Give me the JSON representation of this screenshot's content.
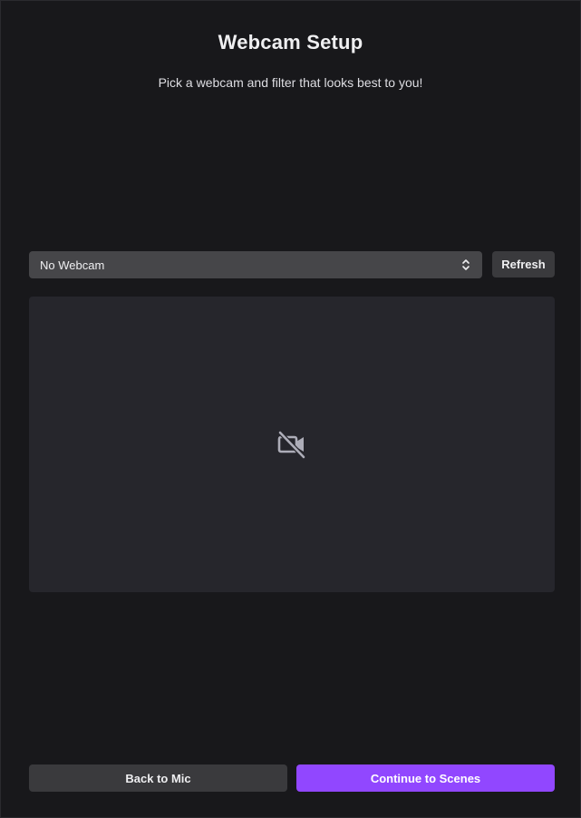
{
  "header": {
    "title": "Webcam Setup",
    "subtitle": "Pick a webcam and filter that looks best to you!"
  },
  "webcam_select": {
    "selected": "No Webcam",
    "icon": "chevron-up-down-icon"
  },
  "refresh_button": {
    "label": "Refresh"
  },
  "preview": {
    "icon": "camera-off-icon"
  },
  "footer": {
    "back_label": "Back to Mic",
    "continue_label": "Continue to Scenes"
  },
  "colors": {
    "background": "#18181b",
    "preview_bg": "#26262c",
    "select_bg": "#464649",
    "secondary_button": "#3a3a3d",
    "accent": "#9147ff"
  }
}
